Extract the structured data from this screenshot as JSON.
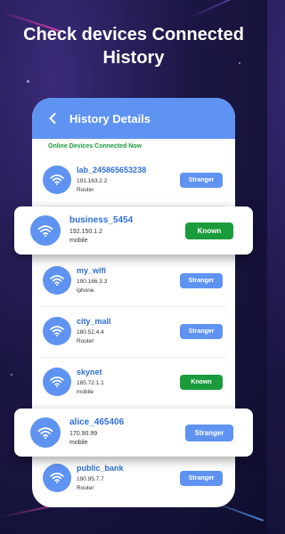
{
  "headline": {
    "line1": "Check devices Connected",
    "line2": "History"
  },
  "app_bar": {
    "title": "History Details",
    "back_icon": "chevron-left-icon"
  },
  "section_label": "Online Devices Connected Now",
  "devices": [
    {
      "name": "lab_245865653238",
      "ip": "191.163.2.2",
      "type": "Router",
      "status": "Stranger"
    },
    {
      "name": "business_5454",
      "ip": "192.150.1.2",
      "type": "mobile",
      "status": "Known"
    },
    {
      "name": "my_wifi",
      "ip": "190.166.3.3",
      "type": "iphone",
      "status": "Stranger"
    },
    {
      "name": "city_mall",
      "ip": "180.52.4.4",
      "type": "Router",
      "status": "Stranger"
    },
    {
      "name": "skynet",
      "ip": "185.72.1.1",
      "type": "mobile",
      "status": "Known"
    },
    {
      "name": "alice_465406",
      "ip": "170.90.99",
      "type": "mobile",
      "status": "Stranger"
    },
    {
      "name": "public_bank",
      "ip": "190.95.7.7",
      "type": "Router",
      "status": "Stranger"
    }
  ],
  "colors": {
    "primary": "#5f93f2",
    "known": "#1a9b3c",
    "background": "#1b1745"
  },
  "icons": {
    "device": "wifi-icon"
  }
}
